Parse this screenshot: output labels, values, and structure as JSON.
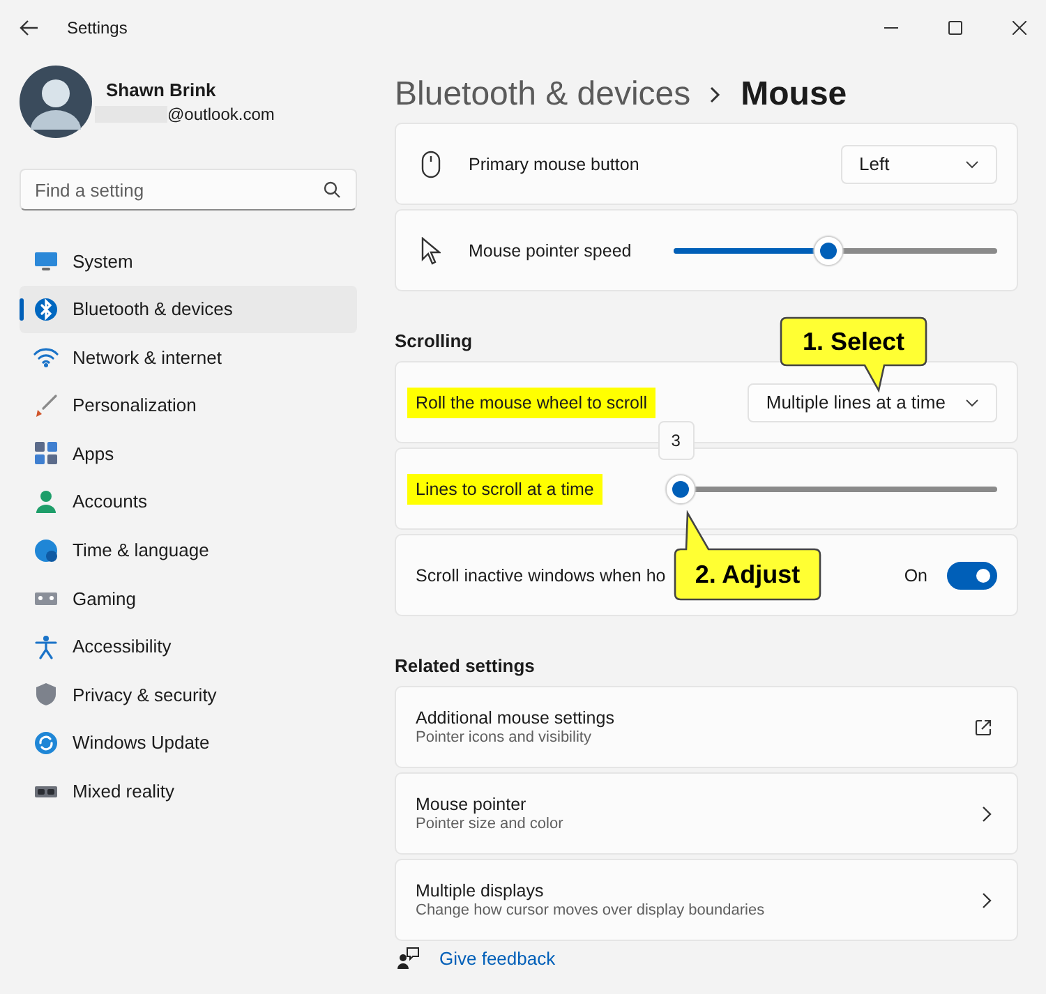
{
  "window": {
    "title": "Settings"
  },
  "profile": {
    "name": "Shawn Brink",
    "email": "@outlook.com"
  },
  "search": {
    "placeholder": "Find a setting"
  },
  "sidebar": {
    "items": [
      {
        "label": "System",
        "selected": false
      },
      {
        "label": "Bluetooth & devices",
        "selected": true
      },
      {
        "label": "Network & internet",
        "selected": false
      },
      {
        "label": "Personalization",
        "selected": false
      },
      {
        "label": "Apps",
        "selected": false
      },
      {
        "label": "Accounts",
        "selected": false
      },
      {
        "label": "Time & language",
        "selected": false
      },
      {
        "label": "Gaming",
        "selected": false
      },
      {
        "label": "Accessibility",
        "selected": false
      },
      {
        "label": "Privacy & security",
        "selected": false
      },
      {
        "label": "Windows Update",
        "selected": false
      },
      {
        "label": "Mixed reality",
        "selected": false
      }
    ]
  },
  "breadcrumb": {
    "parent": "Bluetooth & devices",
    "current": "Mouse"
  },
  "sections": [
    {
      "cards": [
        {
          "kind": "dropdown",
          "label": "Primary mouse button",
          "value": "Left",
          "highlighted": false
        },
        {
          "kind": "slider",
          "label": "Mouse pointer speed",
          "level": 0.48,
          "highlighted": false
        }
      ]
    },
    {
      "heading": "Scrolling",
      "cards": [
        {
          "kind": "dropdown",
          "label": "Roll the mouse wheel to scroll",
          "value": "Multiple lines at a time",
          "highlighted": true
        },
        {
          "kind": "slider",
          "label": "Lines to scroll at a time",
          "level": 0.02,
          "reading": "3",
          "highlighted": true
        },
        {
          "kind": "toggle",
          "label": "Scroll inactive windows when ho",
          "on": true,
          "state_label": "On",
          "highlighted": false
        }
      ]
    },
    {
      "heading": "Related settings",
      "cards": [
        {
          "kind": "external",
          "label": "Additional mouse settings",
          "description": "Pointer icons and visibility"
        },
        {
          "kind": "nav",
          "label": "Mouse pointer",
          "description": "Pointer size and color"
        },
        {
          "kind": "nav",
          "label": "Multiple displays",
          "description": "Change how cursor moves over display boundaries"
        }
      ]
    }
  ],
  "feedback": {
    "label": "Give feedback"
  },
  "callouts": [
    {
      "text": "1. Select"
    },
    {
      "text": "2. Adjust"
    }
  ]
}
